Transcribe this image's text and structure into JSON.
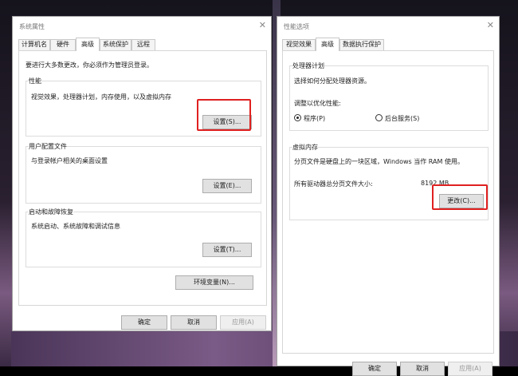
{
  "left": {
    "title": "系统属性",
    "close": "✕",
    "tabs": [
      "计算机名",
      "硬件",
      "高级",
      "系统保护",
      "远程"
    ],
    "admin_note": "要进行大多数更改，你必须作为管理员登录。",
    "performance": {
      "label": "性能",
      "desc": "视觉效果，处理器计划，内存使用，以及虚拟内存",
      "button": "设置(S)..."
    },
    "profiles": {
      "label": "用户配置文件",
      "desc": "与登录帐户相关的桌面设置",
      "button": "设置(E)..."
    },
    "startup": {
      "label": "启动和故障恢复",
      "desc": "系统启动、系统故障和调试信息",
      "button": "设置(T)..."
    },
    "env_button": "环境变量(N)...",
    "ok": "确定",
    "cancel": "取消",
    "apply": "应用(A)"
  },
  "right": {
    "title": "性能选项",
    "close": "✕",
    "tabs": [
      "视觉效果",
      "高级",
      "数据执行保护"
    ],
    "scheduling": {
      "label": "处理器计划",
      "desc": "选择如何分配处理器资源。",
      "adjust": "调整以优化性能:",
      "programs": "程序(P)",
      "services": "后台服务(S)"
    },
    "vm": {
      "label": "虚拟内存",
      "desc": "分页文件是硬盘上的一块区域，Windows 当作 RAM 使用。",
      "total_label": "所有驱动器总分页文件大小:",
      "total_value": "8192 MB",
      "change": "更改(C)..."
    },
    "ok": "确定",
    "cancel": "取消",
    "apply": "应用(A)"
  }
}
